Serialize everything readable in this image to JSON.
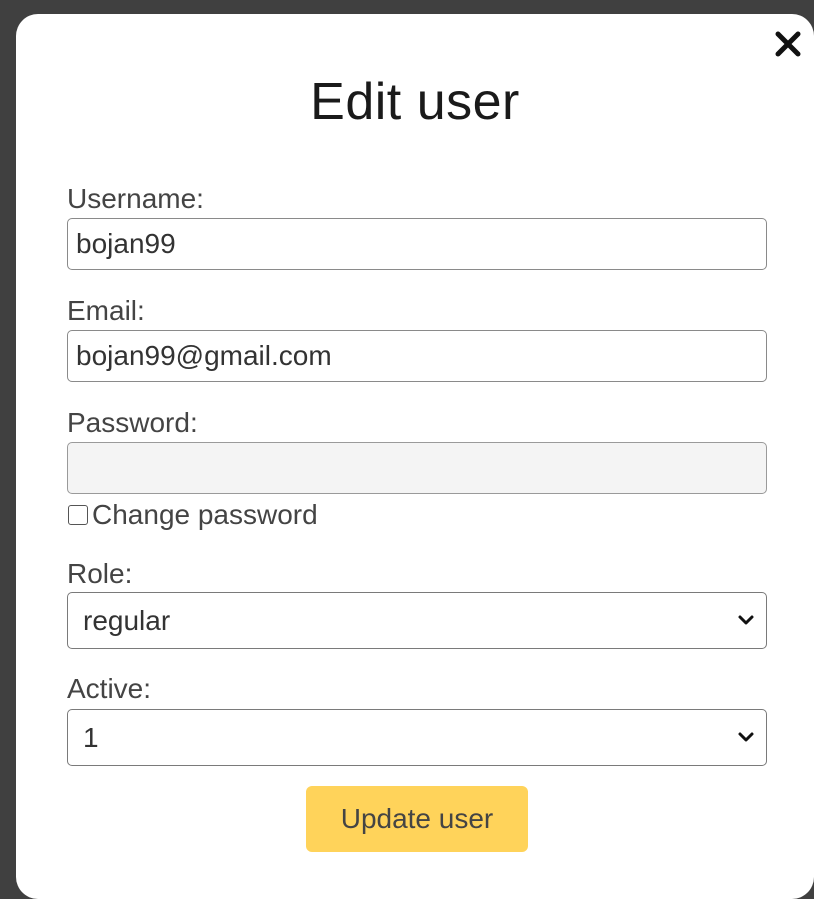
{
  "modal": {
    "title": "Edit user",
    "close_icon": "close-icon"
  },
  "form": {
    "username": {
      "label": "Username:",
      "value": "bojan99"
    },
    "email": {
      "label": "Email:",
      "value": "bojan99@gmail.com"
    },
    "password": {
      "label": "Password:",
      "value": "",
      "disabled": true
    },
    "change_password": {
      "label": "Change password",
      "checked": false
    },
    "role": {
      "label": "Role:",
      "selected": "regular"
    },
    "active": {
      "label": "Active:",
      "selected": "1"
    },
    "submit_label": "Update user"
  },
  "colors": {
    "button": "#ffd35a",
    "backdrop": "#404040",
    "modal": "#ffffff"
  }
}
